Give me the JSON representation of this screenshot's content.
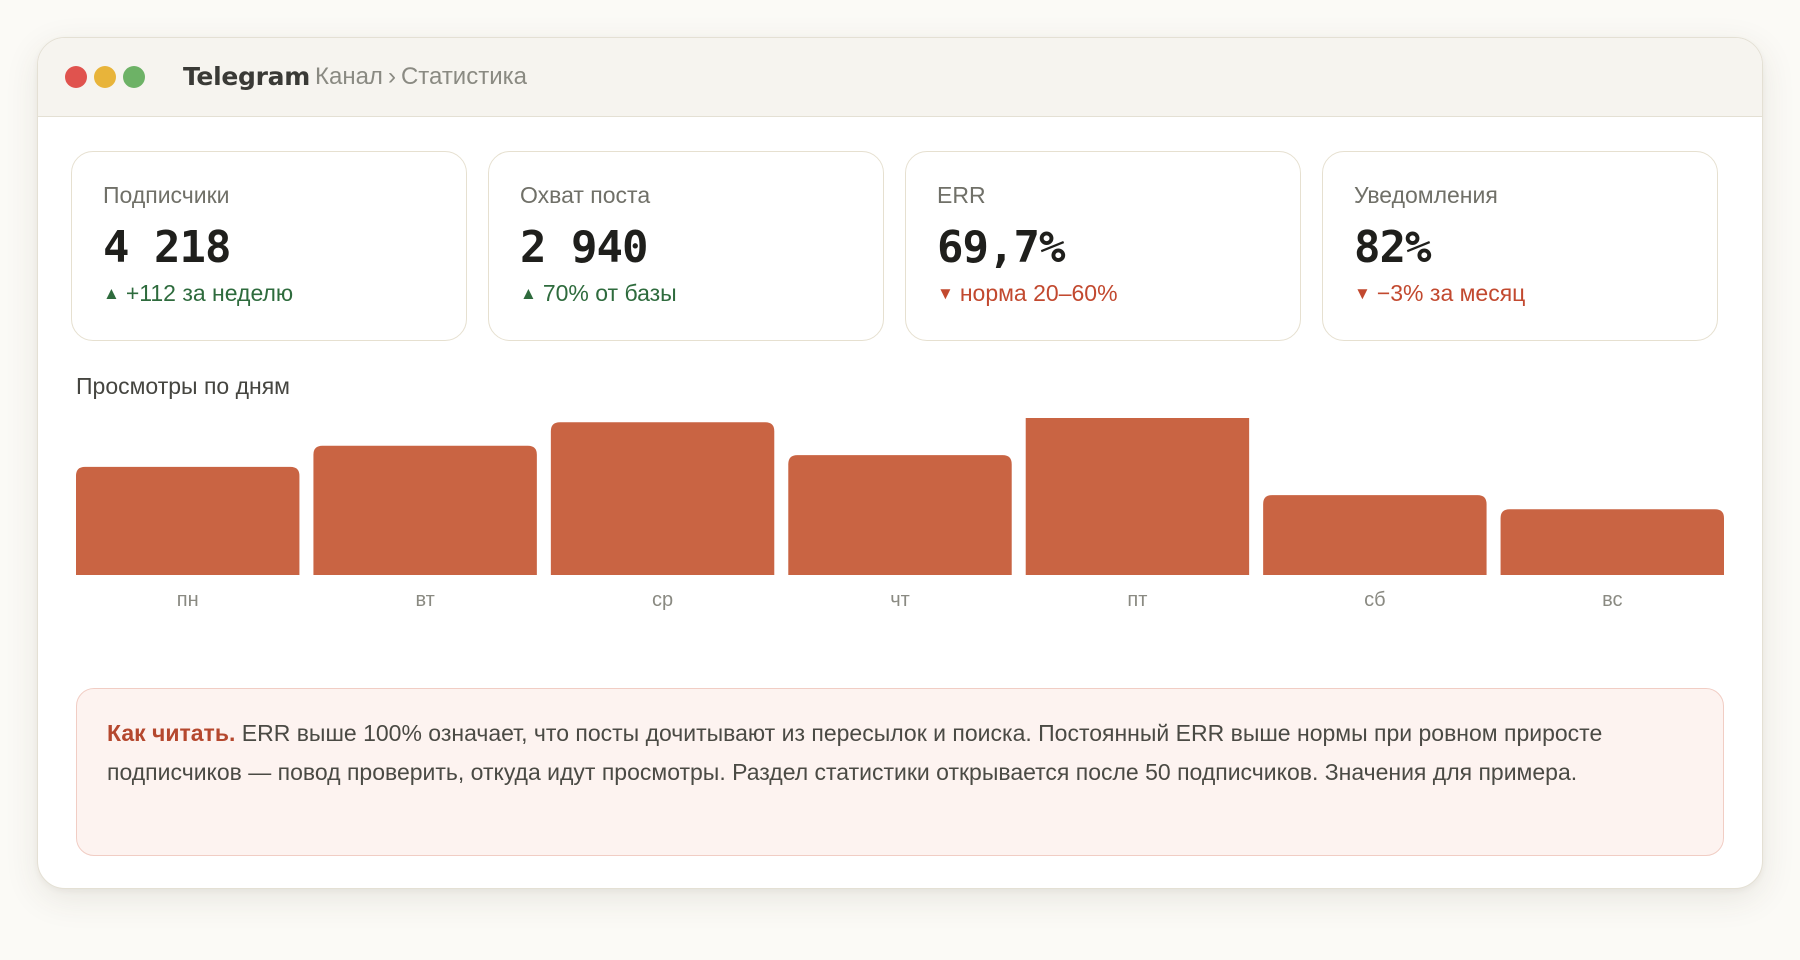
{
  "window": {
    "app_title": "Telegram",
    "breadcrumb": [
      "Канал",
      "Статистика"
    ],
    "breadcrumb_separator": "›"
  },
  "traffic_lights": {
    "close_color": "#e0534e",
    "minimize_color": "#e8b43a",
    "zoom_color": "#6db266"
  },
  "stats": [
    {
      "label": "Подписчики",
      "value": "4 218",
      "delta": "+112 за неделю",
      "trend": "up",
      "arrow": "▲"
    },
    {
      "label": "Охват поста",
      "value": "2 940",
      "delta": "70% от базы",
      "trend": "up",
      "arrow": "▲"
    },
    {
      "label": "ERR",
      "value": "69,7%",
      "delta": "норма 20–60%",
      "trend": "down",
      "arrow": "▼"
    },
    {
      "label": "Уведомления",
      "value": "82%",
      "delta": "−3% за месяц",
      "trend": "down",
      "arrow": "▼"
    }
  ],
  "colors": {
    "accent": "#c96443",
    "up": "#2e6b3d",
    "down": "#c2492f"
  },
  "chart_data": {
    "type": "bar",
    "title": "Просмотры по дням",
    "categories": [
      "пн",
      "вт",
      "ср",
      "чт",
      "пт",
      "сб",
      "вс"
    ],
    "values": [
      46,
      55,
      65,
      51,
      75,
      34,
      28
    ],
    "ylim": [
      0,
      100
    ],
    "color": "#c96443",
    "grid": false,
    "legend": "none"
  },
  "note": {
    "title": "Как читать.",
    "text": "ERR выше 100% означает, что посты дочитывают из пересылок и поиска. Постоянный ERR выше нормы при ровном приросте подписчиков — повод проверить, откуда идут просмотры. Раздел статистики открывается после 50 подписчиков. Значения для примера."
  }
}
